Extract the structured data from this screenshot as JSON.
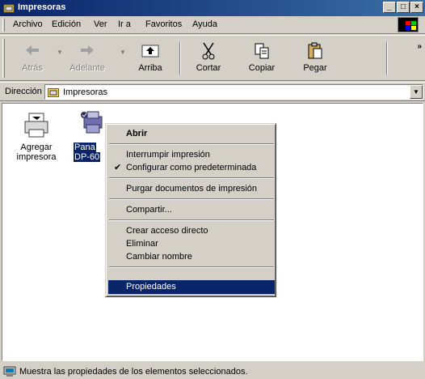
{
  "window": {
    "title": "Impresoras"
  },
  "menu": {
    "items": [
      "Archivo",
      "Edición",
      "Ver",
      "Ir a",
      "Favoritos",
      "Ayuda"
    ]
  },
  "toolbar": {
    "back": "Atrás",
    "forward": "Adelante",
    "up": "Arriba",
    "cut": "Cortar",
    "copy": "Copiar",
    "paste": "Pegar"
  },
  "address": {
    "label": "Dirección",
    "value": "Impresoras"
  },
  "content": {
    "items": [
      {
        "label_line1": "Agregar",
        "label_line2": "impresora"
      },
      {
        "label_line1": "Pana",
        "label_line2": "DP-60"
      }
    ]
  },
  "context_menu": {
    "items": [
      {
        "label": "Abrir",
        "default": true
      },
      {
        "label": "Interrumpir impresión"
      },
      {
        "label": "Configurar como predeterminada",
        "checked": true
      },
      {
        "label": "Purgar documentos de impresión"
      },
      {
        "label": "Compartir..."
      },
      {
        "label": "Crear acceso directo"
      },
      {
        "label": "Eliminar"
      },
      {
        "label": "Cambiar nombre"
      },
      {
        "label": "Propiedades",
        "highlighted": true
      }
    ],
    "check_glyph": "✔"
  },
  "statusbar": {
    "text": "Muestra las propiedades de los elementos seleccionados."
  },
  "colors": {
    "titlebar": "#0a246a",
    "highlight": "#0a246a",
    "face": "#d4d0c8"
  }
}
